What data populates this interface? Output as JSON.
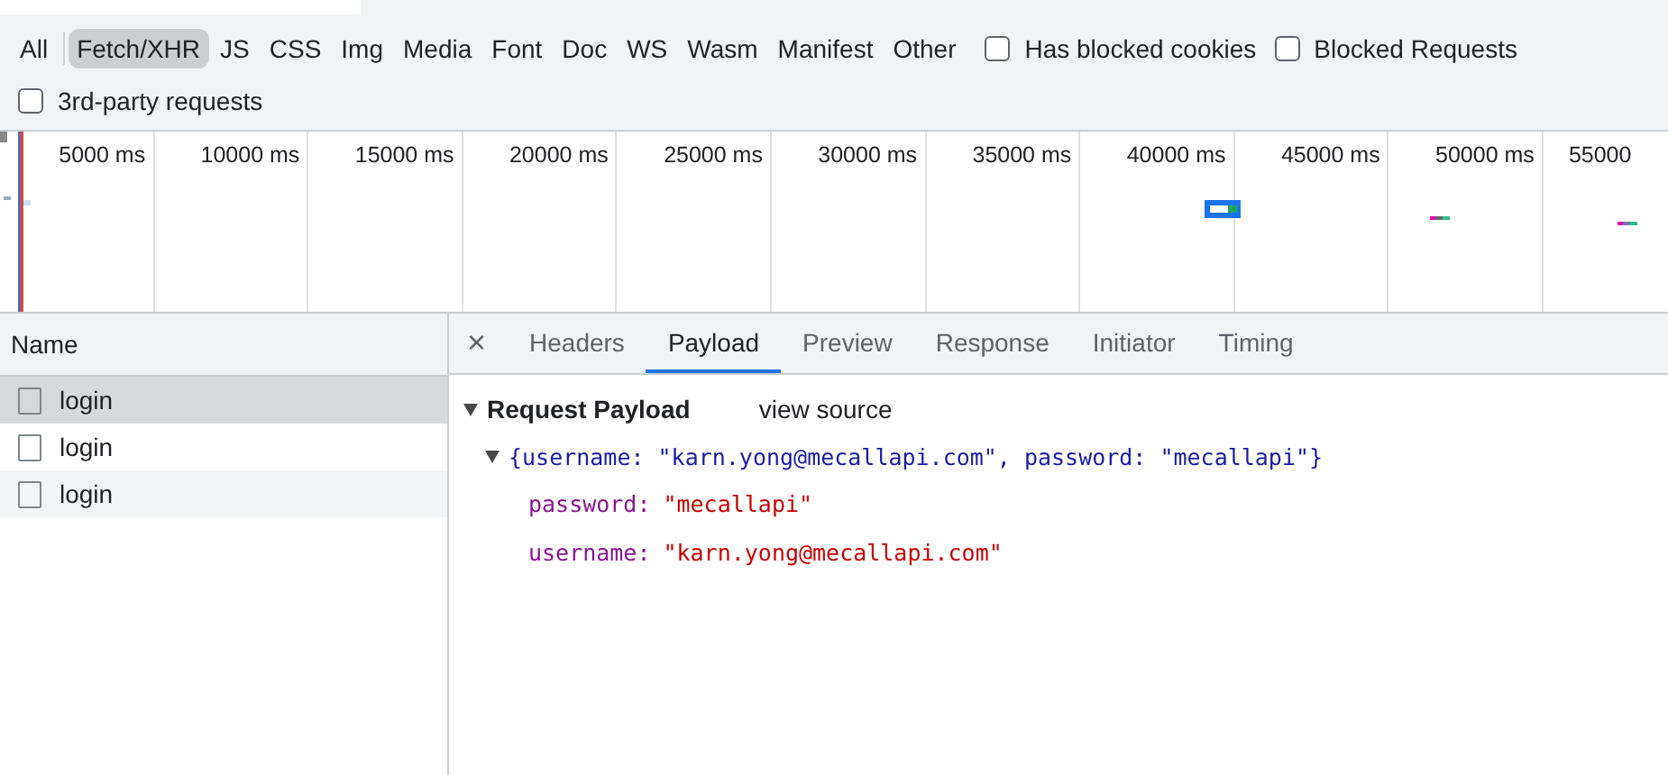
{
  "type_filters": [
    {
      "label": "All",
      "selected": false
    },
    {
      "label": "Fetch/XHR",
      "selected": true
    },
    {
      "label": "JS",
      "selected": false
    },
    {
      "label": "CSS",
      "selected": false
    },
    {
      "label": "Img",
      "selected": false
    },
    {
      "label": "Media",
      "selected": false
    },
    {
      "label": "Font",
      "selected": false
    },
    {
      "label": "Doc",
      "selected": false
    },
    {
      "label": "WS",
      "selected": false
    },
    {
      "label": "Wasm",
      "selected": false
    },
    {
      "label": "Manifest",
      "selected": false
    },
    {
      "label": "Other",
      "selected": false
    }
  ],
  "filter_checkboxes": [
    {
      "label": "Has blocked cookies",
      "checked": false
    },
    {
      "label": "Blocked Requests",
      "checked": false
    },
    {
      "label": "3rd-party requests",
      "checked": false
    }
  ],
  "timeline": {
    "ticks": [
      "5000 ms",
      "10000 ms",
      "15000 ms",
      "20000 ms",
      "25000 ms",
      "30000 ms",
      "35000 ms",
      "40000 ms",
      "45000 ms",
      "50000 ms",
      "55000"
    ]
  },
  "requests": {
    "header": "Name",
    "rows": [
      {
        "name": "login",
        "selected": true
      },
      {
        "name": "login",
        "selected": false
      },
      {
        "name": "login",
        "selected": false
      }
    ]
  },
  "detail": {
    "close": "×",
    "tabs": [
      {
        "label": "Headers",
        "selected": false
      },
      {
        "label": "Payload",
        "selected": true
      },
      {
        "label": "Preview",
        "selected": false
      },
      {
        "label": "Response",
        "selected": false
      },
      {
        "label": "Initiator",
        "selected": false
      },
      {
        "label": "Timing",
        "selected": false
      }
    ],
    "section": {
      "title": "Request Payload",
      "expanded": true,
      "link": "view source",
      "object": {
        "summary": "{username: \"karn.yong@mecallapi.com\", password: \"mecallapi\"}",
        "expanded": true,
        "properties": [
          {
            "key": "password:",
            "value": "\"mecallapi\""
          },
          {
            "key": "username:",
            "value": "\"karn.yong@mecallapi.com\""
          }
        ]
      }
    }
  }
}
